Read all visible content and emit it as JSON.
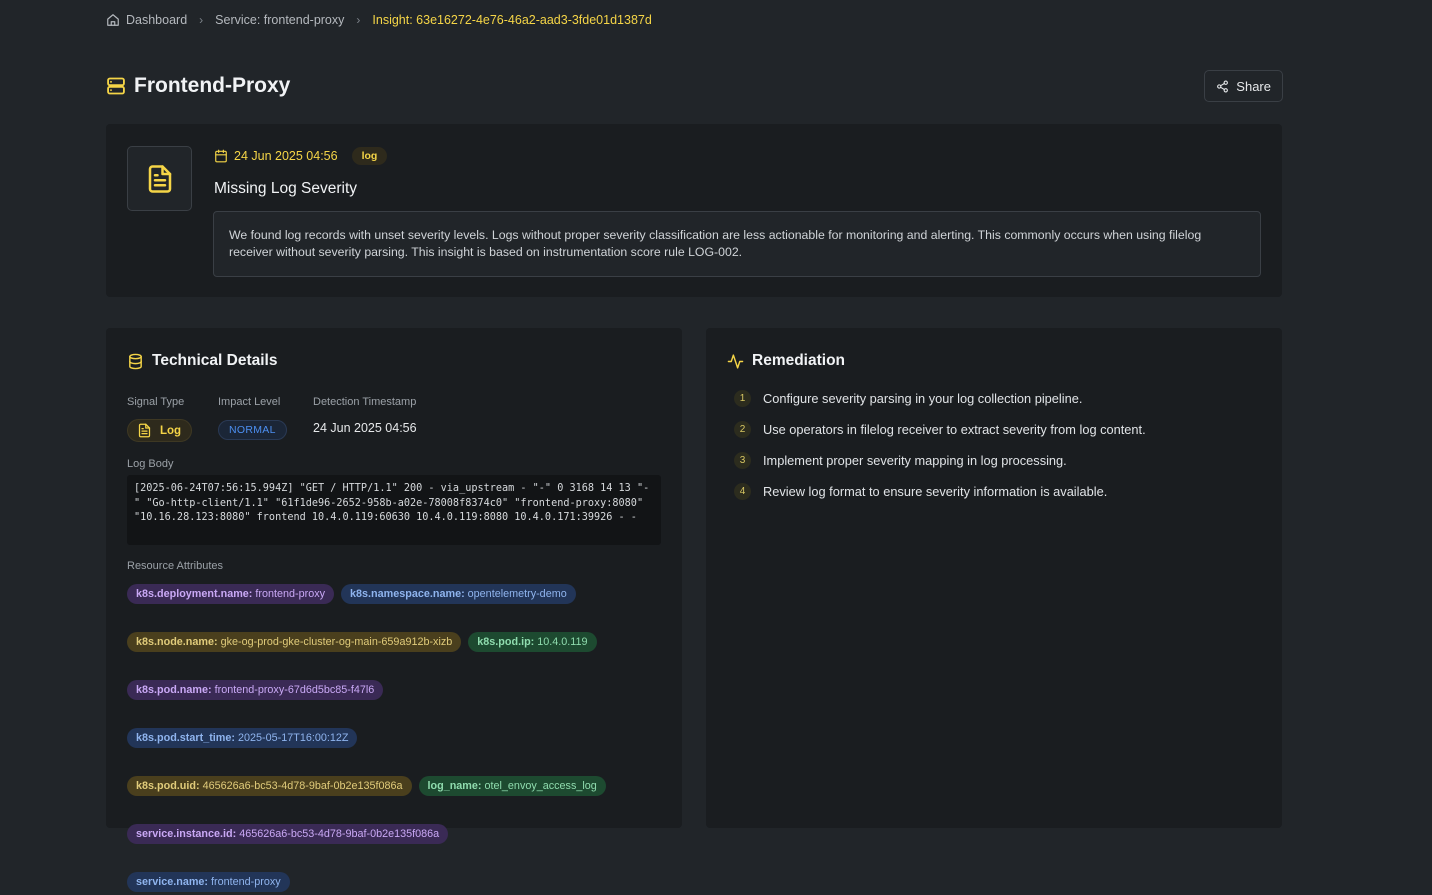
{
  "breadcrumb": {
    "home": "Dashboard",
    "service": "Service: frontend-proxy",
    "insight": "Insight: 63e16272-4e76-46a2-aad3-3fde01d1387d"
  },
  "header": {
    "title": "Frontend-Proxy",
    "share_label": "Share"
  },
  "insight": {
    "timestamp": "24 Jun 2025 04:56",
    "tag": "log",
    "title": "Missing Log Severity",
    "description": "We found log records with unset severity levels. Logs without proper severity classification are less actionable for monitoring and alerting. This commonly occurs when using filelog receiver without severity parsing. This insight is based on instrumentation score rule LOG-002."
  },
  "technical": {
    "heading": "Technical Details",
    "signal_type_label": "Signal Type",
    "signal_type": "Log",
    "impact_label": "Impact Level",
    "impact": "NORMAL",
    "detection_label": "Detection Timestamp",
    "detection": "24 Jun 2025 04:56",
    "log_body_label": "Log Body",
    "log_body": "[2025-06-24T07:56:15.994Z] \"GET / HTTP/1.1\" 200 - via_upstream - \"-\" 0 3168 14 13 \"-\" \"Go-http-client/1.1\" \"61f1de96-2652-958b-a02e-78008f8374c0\" \"frontend-proxy:8080\" \"10.16.28.123:8080\" frontend 10.4.0.119:60630 10.4.0.119:8080 10.4.0.171:39926 - -",
    "resource_label": "Resource Attributes",
    "attributes": [
      {
        "key": "k8s.deployment.name:",
        "value": "frontend-proxy",
        "color": "#3a2a55"
      },
      {
        "key": "k8s.namespace.name:",
        "value": "opentelemetry-demo",
        "color": "#223558"
      },
      {
        "key": "k8s.node.name:",
        "value": "gke-og-prod-gke-cluster-og-main-659a912b-xizb",
        "color": "#4a3f1d"
      },
      {
        "key": "k8s.pod.ip:",
        "value": "10.4.0.119",
        "color": "#1d4a30"
      },
      {
        "key": "k8s.pod.name:",
        "value": "frontend-proxy-67d6d5bc85-f47l6",
        "color": "#3a2a55"
      },
      {
        "key": "k8s.pod.start_time:",
        "value": "2025-05-17T16:00:12Z",
        "color": "#223558"
      },
      {
        "key": "k8s.pod.uid:",
        "value": "465626a6-bc53-4d78-9baf-0b2e135f086a",
        "color": "#4a3f1d"
      },
      {
        "key": "log_name:",
        "value": "otel_envoy_access_log",
        "color": "#1d4a30"
      },
      {
        "key": "service.instance.id:",
        "value": "465626a6-bc53-4d78-9baf-0b2e135f086a",
        "color": "#3a2a55"
      },
      {
        "key": "service.name:",
        "value": "frontend-proxy",
        "color": "#223558"
      }
    ]
  },
  "remediation": {
    "heading": "Remediation",
    "steps": [
      {
        "num": "1",
        "text": "Configure severity parsing in your log collection pipeline."
      },
      {
        "num": "2",
        "text": "Use operators in filelog receiver to extract severity from log content."
      },
      {
        "num": "3",
        "text": "Implement proper severity mapping in log processing."
      },
      {
        "num": "4",
        "text": "Review log format to ensure severity information is available."
      }
    ]
  },
  "icons": [
    "home-icon",
    "server-icon",
    "share-icon",
    "document-icon",
    "calendar-icon",
    "database-icon",
    "activity-icon"
  ],
  "colors": {
    "accent": "#f5d547",
    "background": "#212529",
    "card": "#1a1d20",
    "impact_blue": "#4c8ff1"
  }
}
